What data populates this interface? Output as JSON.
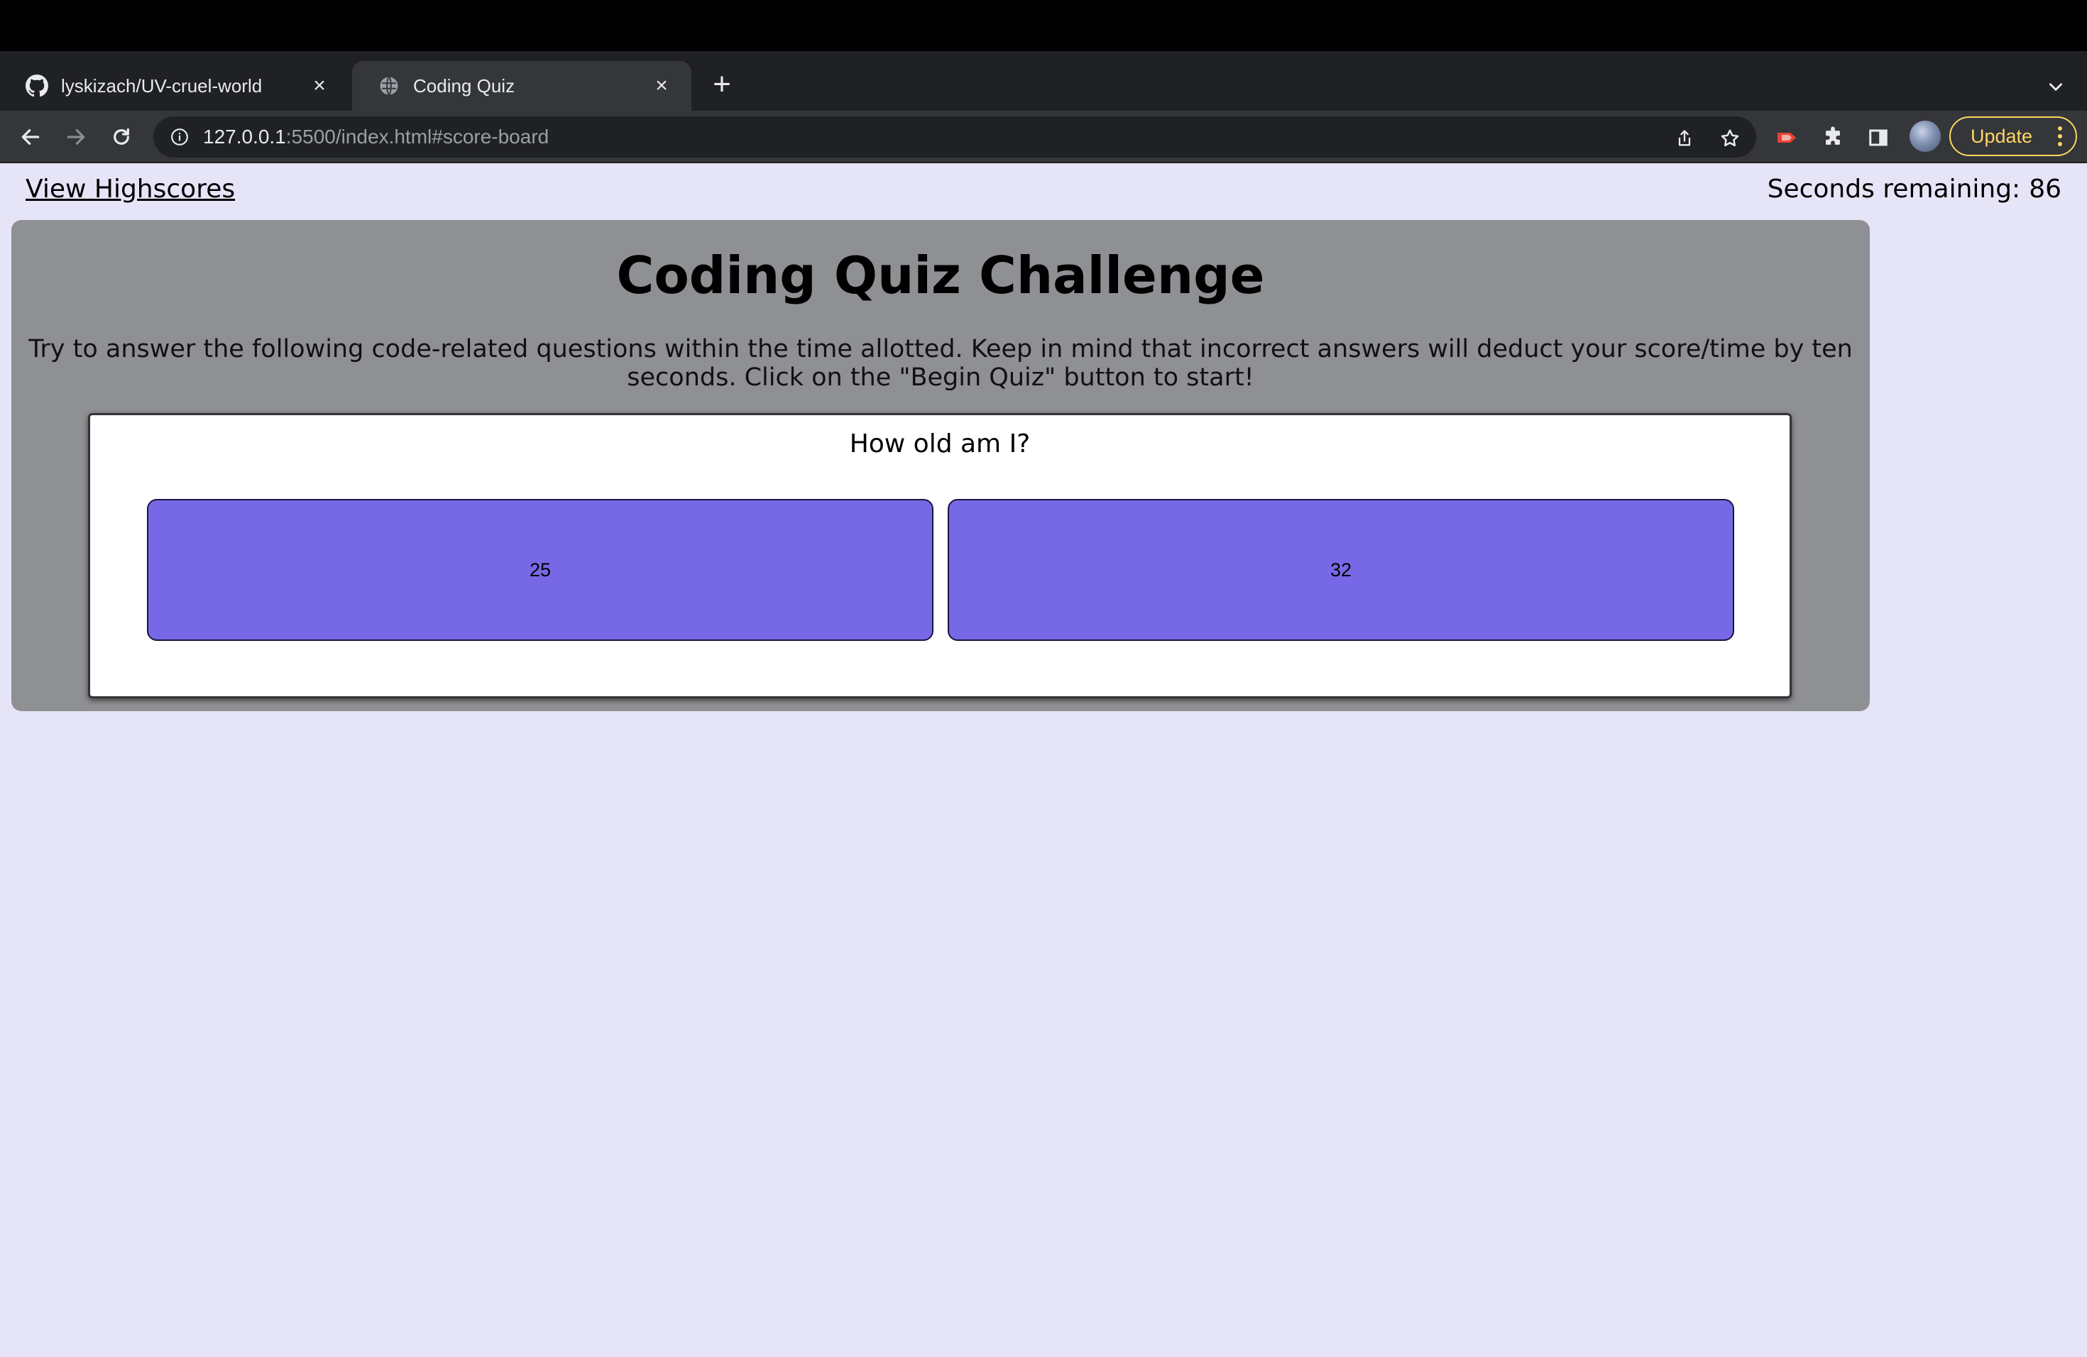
{
  "browser": {
    "tabs": [
      {
        "title": "lyskizach/UV-cruel-world",
        "favicon": "github-icon",
        "active": false
      },
      {
        "title": "Coding Quiz",
        "favicon": "globe-icon",
        "active": true
      }
    ],
    "address_bar": {
      "host": "127.0.0.1",
      "rest": ":5500/index.html#score-board"
    },
    "update_label": "Update"
  },
  "header": {
    "highscores_link": "View Highscores",
    "timer_label": "Seconds remaining:",
    "timer_value": "86"
  },
  "quiz": {
    "title": "Coding Quiz Challenge",
    "description": "Try to answer the following code-related questions within the time allotted. Keep in mind that incorrect answers will deduct your score/time by ten seconds. Click on the \"Begin Quiz\" button to start!",
    "question": "How old am I?",
    "answers": [
      "25",
      "32"
    ]
  },
  "colors": {
    "page_background": "#e6e4f7",
    "card_background": "#8f9094",
    "answer_button": "#7769e6",
    "update_accent": "#fdd663"
  }
}
